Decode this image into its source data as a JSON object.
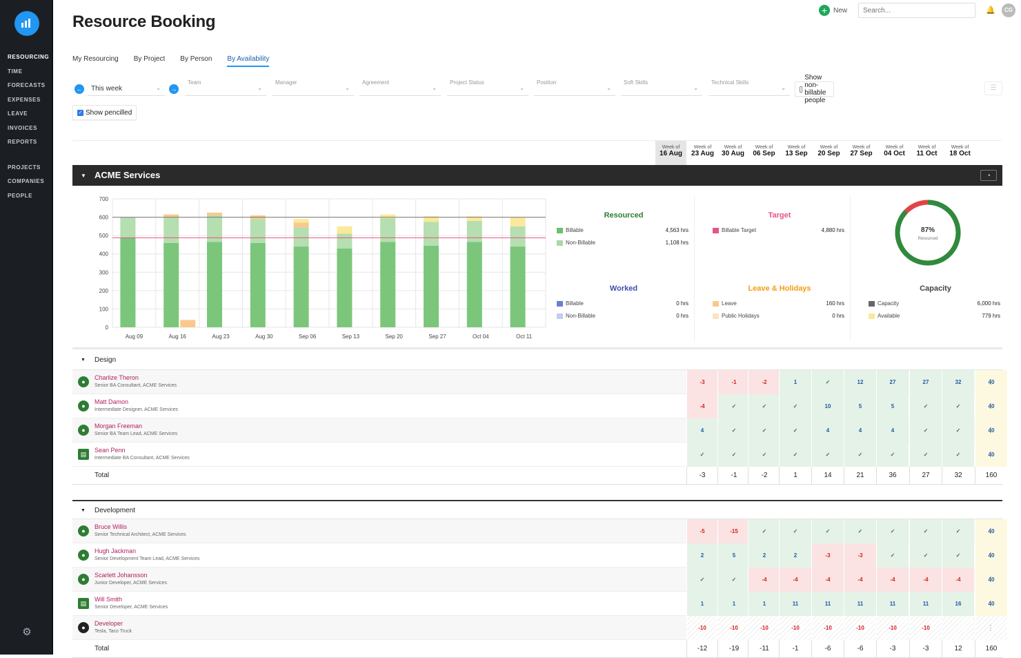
{
  "nav": {
    "items": [
      {
        "label": "RESOURCING",
        "top": 78
      },
      {
        "label": "TIME",
        "top": 99
      },
      {
        "label": "FORECASTS",
        "top": 119
      },
      {
        "label": "EXPENSES",
        "top": 140
      },
      {
        "label": "LEAVE",
        "top": 160
      },
      {
        "label": "INVOICES",
        "top": 181
      },
      {
        "label": "REPORTS",
        "top": 201
      },
      {
        "label": "PROJECTS",
        "top": 238
      },
      {
        "label": "COMPANIES",
        "top": 258
      },
      {
        "label": "PEOPLE",
        "top": 279
      }
    ]
  },
  "header": {
    "title": "Resource Booking",
    "new_label": "New",
    "search_placeholder": "Search...",
    "avatar": "CG"
  },
  "tabs": [
    "My Resourcing",
    "By Project",
    "By Person",
    "By Availability"
  ],
  "filters": {
    "period": "This week",
    "labels": [
      "Team",
      "Manager",
      "Agreement",
      "Project Status",
      "Position",
      "Soft Skills",
      "Technical Skills"
    ],
    "nonbillable_label": "Show non-billable people",
    "pencilled_label": "Show pencilled"
  },
  "weeks": [
    {
      "s": "Week of",
      "d": "16 Aug"
    },
    {
      "s": "Week of",
      "d": "23 Aug"
    },
    {
      "s": "Week of",
      "d": "30 Aug"
    },
    {
      "s": "Week of",
      "d": "06 Sep"
    },
    {
      "s": "Week of",
      "d": "13 Sep"
    },
    {
      "s": "Week of",
      "d": "20 Sep"
    },
    {
      "s": "Week of",
      "d": "27 Sep"
    },
    {
      "s": "Week of",
      "d": "04 Oct"
    },
    {
      "s": "Week of",
      "d": "11 Oct"
    },
    {
      "s": "Week of",
      "d": "18 Oct"
    }
  ],
  "section": {
    "title": "ACME Services"
  },
  "chart_data": {
    "type": "bar",
    "categories": [
      "Aug 09",
      "Aug 16",
      "Aug 23",
      "Aug 30",
      "Sep 06",
      "Sep 13",
      "Sep 20",
      "Sep 27",
      "Oct 04",
      "Oct 11"
    ],
    "yticks": [
      0,
      100,
      200,
      300,
      400,
      500,
      600,
      700
    ],
    "ylim": [
      0,
      700
    ],
    "target": 488,
    "capacity": 600,
    "series": [
      {
        "name": "Billable",
        "color": "#7bc67b",
        "values": [
          490,
          460,
          465,
          460,
          440,
          430,
          465,
          445,
          465,
          440
        ]
      },
      {
        "name": "Non-Billable",
        "color": "#b5deb1",
        "values": [
          110,
          140,
          145,
          130,
          105,
          80,
          130,
          130,
          115,
          110
        ]
      },
      {
        "name": "Leave",
        "color": "#f9c98c",
        "values": [
          0,
          40,
          0,
          0,
          0,
          0,
          0,
          0,
          0,
          0
        ]
      },
      {
        "name": "Leave (stacked)",
        "color": "#f9c98c",
        "values": [
          0,
          15,
          15,
          20,
          25,
          0,
          0,
          0,
          0,
          0
        ]
      },
      {
        "name": "Available",
        "color": "#fbe89a",
        "values": [
          0,
          0,
          0,
          0,
          20,
          40,
          20,
          30,
          25,
          50
        ]
      }
    ],
    "leave_bar_values": [
      0,
      40,
      0,
      0,
      0,
      0,
      0,
      0,
      0,
      0
    ]
  },
  "stats": {
    "resourced": {
      "title": "Resourced",
      "rows": [
        {
          "name": "Billable",
          "value": "4,563 hrs",
          "color": "#6cbf6c"
        },
        {
          "name": "Non-Billable",
          "value": "1,108 hrs",
          "color": "#a9d9a4"
        }
      ]
    },
    "target": {
      "title": "Target",
      "rows": [
        {
          "name": "Billable Target",
          "value": "4,880 hrs",
          "color": "#e75480"
        }
      ]
    },
    "worked": {
      "title": "Worked",
      "rows": [
        {
          "name": "Billable",
          "value": "0 hrs",
          "color": "#6a7fd0"
        },
        {
          "name": "Non-Billable",
          "value": "0 hrs",
          "color": "#c5cbed"
        }
      ]
    },
    "leave": {
      "title": "Leave & Holidays",
      "rows": [
        {
          "name": "Leave",
          "value": "160 hrs",
          "color": "#f9c98c"
        },
        {
          "name": "Public Holidays",
          "value": "0 hrs",
          "color": "#fbe3c2"
        }
      ]
    },
    "capacity": {
      "title": "Capacity",
      "rows": [
        {
          "name": "Capacity",
          "value": "6,000 hrs",
          "color": "#666"
        },
        {
          "name": "Available",
          "value": "779 hrs",
          "color": "#fbe89a"
        }
      ]
    },
    "donut": {
      "percent": "87%",
      "label": "Resourced",
      "value": 0.87
    }
  },
  "groups": [
    {
      "title": "Design",
      "rows": [
        {
          "name": "Charlize Theron",
          "role": "Senior BA Consultant, ACME Services",
          "icon": "person",
          "cells": [
            [
              "r",
              "-3"
            ],
            [
              "r",
              "-1"
            ],
            [
              "r",
              "-2"
            ],
            [
              "b",
              "1"
            ],
            [
              "g",
              "✓"
            ],
            [
              "b",
              "12"
            ],
            [
              "b",
              "27"
            ],
            [
              "b",
              "27"
            ],
            [
              "b",
              "32"
            ],
            [
              "y",
              "40"
            ]
          ]
        },
        {
          "name": "Matt Damon",
          "role": "Intermediate Designer, ACME Services",
          "icon": "person",
          "cells": [
            [
              "r",
              "-4"
            ],
            [
              "g",
              "✓"
            ],
            [
              "g",
              "✓"
            ],
            [
              "g",
              "✓"
            ],
            [
              "b",
              "10"
            ],
            [
              "b",
              "5"
            ],
            [
              "b",
              "5"
            ],
            [
              "g",
              "✓"
            ],
            [
              "g",
              "✓"
            ],
            [
              "y",
              "40"
            ]
          ]
        },
        {
          "name": "Morgan Freeman",
          "role": "Senior BA Team Lead, ACME Services",
          "icon": "person",
          "cells": [
            [
              "b",
              "4"
            ],
            [
              "g",
              "✓"
            ],
            [
              "g",
              "✓"
            ],
            [
              "g",
              "✓"
            ],
            [
              "b",
              "4"
            ],
            [
              "b",
              "4"
            ],
            [
              "b",
              "4"
            ],
            [
              "g",
              "✓"
            ],
            [
              "g",
              "✓"
            ],
            [
              "y",
              "40"
            ]
          ]
        },
        {
          "name": "Sean Penn",
          "role": "Intermediate BA Consultant, ACME Services",
          "icon": "badge",
          "cells": [
            [
              "g",
              "✓"
            ],
            [
              "g",
              "✓"
            ],
            [
              "g",
              "✓"
            ],
            [
              "g",
              "✓"
            ],
            [
              "g",
              "✓"
            ],
            [
              "g",
              "✓"
            ],
            [
              "g",
              "✓"
            ],
            [
              "g",
              "✓"
            ],
            [
              "g",
              "✓"
            ],
            [
              "y",
              "40"
            ]
          ]
        }
      ],
      "total_label": "Total",
      "totals": [
        "-3",
        "-1",
        "-2",
        "1",
        "14",
        "21",
        "36",
        "27",
        "32",
        "160"
      ]
    },
    {
      "title": "Development",
      "rows": [
        {
          "name": "Bruce Willis",
          "role": "Senior Technical Architect, ACME Services",
          "icon": "person",
          "cells": [
            [
              "r",
              "-5"
            ],
            [
              "r",
              "-15"
            ],
            [
              "g",
              "✓"
            ],
            [
              "g",
              "✓"
            ],
            [
              "g",
              "✓"
            ],
            [
              "g",
              "✓"
            ],
            [
              "g",
              "✓"
            ],
            [
              "g",
              "✓"
            ],
            [
              "g",
              "✓"
            ],
            [
              "y",
              "40"
            ]
          ]
        },
        {
          "name": "Hugh Jackman",
          "role": "Senior Development Team Lead, ACME Services",
          "icon": "person",
          "cells": [
            [
              "b",
              "2"
            ],
            [
              "b",
              "5"
            ],
            [
              "b",
              "2"
            ],
            [
              "b",
              "2"
            ],
            [
              "r",
              "-3"
            ],
            [
              "r",
              "-3"
            ],
            [
              "g",
              "✓"
            ],
            [
              "g",
              "✓"
            ],
            [
              "g",
              "✓"
            ],
            [
              "y",
              "40"
            ]
          ]
        },
        {
          "name": "Scarlett Johansson",
          "role": "Junior Developer, ACME Services",
          "icon": "person",
          "cells": [
            [
              "g",
              "✓"
            ],
            [
              "g",
              "✓"
            ],
            [
              "r",
              "-4"
            ],
            [
              "r",
              "-4"
            ],
            [
              "r",
              "-4"
            ],
            [
              "r",
              "-4"
            ],
            [
              "r",
              "-4"
            ],
            [
              "r",
              "-4"
            ],
            [
              "r",
              "-4"
            ],
            [
              "y",
              "40"
            ]
          ]
        },
        {
          "name": "Will Smith",
          "role": "Senior Developer, ACME Services",
          "icon": "badge",
          "cells": [
            [
              "b",
              "1"
            ],
            [
              "b",
              "1"
            ],
            [
              "b",
              "1"
            ],
            [
              "b",
              "11"
            ],
            [
              "b",
              "11"
            ],
            [
              "b",
              "11"
            ],
            [
              "b",
              "11"
            ],
            [
              "b",
              "11"
            ],
            [
              "b",
              "16"
            ],
            [
              "y",
              "40"
            ]
          ]
        },
        {
          "name": "Developer",
          "role": "Tesla, Taco Truck",
          "icon": "dark",
          "cells": [
            [
              "h",
              "-10"
            ],
            [
              "h",
              "-10"
            ],
            [
              "h",
              "-10"
            ],
            [
              "h",
              "-10"
            ],
            [
              "h",
              "-10"
            ],
            [
              "h",
              "-10"
            ],
            [
              "h",
              "-10"
            ],
            [
              "h",
              "-10"
            ],
            [
              "h",
              ""
            ],
            [
              "h",
              ""
            ]
          ]
        }
      ],
      "total_label": "Total",
      "totals": [
        "-12",
        "-19",
        "-11",
        "-1",
        "-6",
        "-6",
        "-3",
        "-3",
        "12",
        "160"
      ]
    }
  ]
}
